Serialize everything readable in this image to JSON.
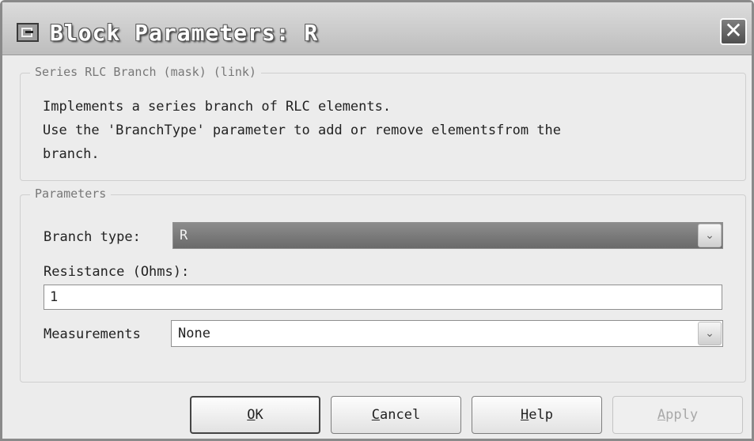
{
  "window": {
    "title": "Block Parameters: R",
    "close_label": "✕"
  },
  "description": {
    "legend": "Series RLC Branch (mask) (link)",
    "text": "Implements a series branch of RLC elements.\nUse the 'BranchType' parameter to add or remove elementsfrom the\nbranch."
  },
  "parameters": {
    "legend": "Parameters",
    "branch_type": {
      "label": "Branch type:",
      "value": "R"
    },
    "resistance": {
      "label": "Resistance (Ohms):",
      "value": "1"
    },
    "measurements": {
      "label": "Measurements",
      "value": "None"
    },
    "dropdown_arrow": "⌄"
  },
  "buttons": {
    "ok": {
      "prefix": "",
      "mnemonic": "O",
      "rest": "K"
    },
    "cancel": {
      "prefix": "",
      "mnemonic": "C",
      "rest": "ancel"
    },
    "help": {
      "prefix": "",
      "mnemonic": "H",
      "rest": "elp"
    },
    "apply": {
      "prefix": "",
      "mnemonic": "A",
      "rest": "pply"
    }
  }
}
